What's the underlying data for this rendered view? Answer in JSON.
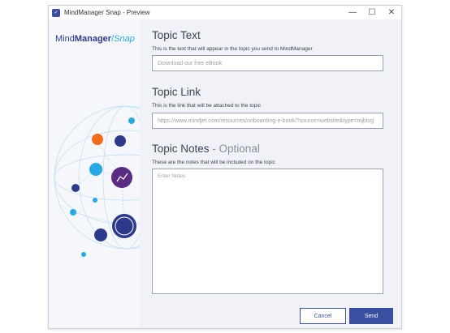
{
  "window": {
    "title": "MindManager Snap - Preview",
    "controls": {
      "minimize": "—",
      "maximize": "☐",
      "close": "✕"
    }
  },
  "logo": {
    "brand_a": "Mind",
    "brand_b": "Manager",
    "slash": "/",
    "brand_c": "Snap"
  },
  "form": {
    "text": {
      "title": "Topic Text",
      "desc": "This is the text that will appear in the topic you send to MindManager",
      "placeholder": "Download our free eBook"
    },
    "link": {
      "title": "Topic Link",
      "desc": "This is the link that will be attached to the topic",
      "value": "https://www.mindjet.com/resources/onboarding-e-book/?source=website&type=mjblog"
    },
    "notes": {
      "title": "Topic Notes",
      "title_optional": " - Optional",
      "desc": "These are the notes that will be included on the topic",
      "placeholder": "Enter Notes"
    }
  },
  "buttons": {
    "cancel": "Cancel",
    "send": "Send"
  },
  "colors": {
    "primary": "#3b4fa0",
    "accent": "#27a9e1",
    "orange": "#f26b1d",
    "purple": "#5a2d83"
  }
}
